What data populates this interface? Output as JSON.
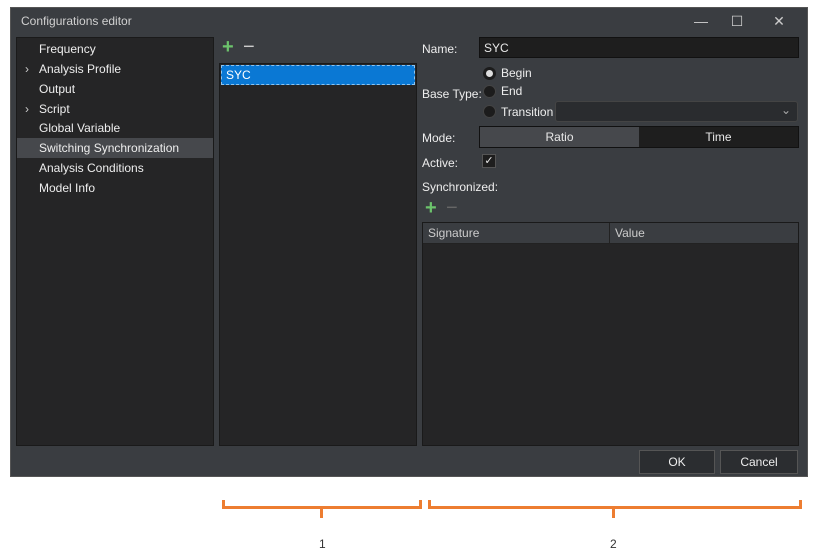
{
  "window": {
    "title": "Configurations editor",
    "controls": [
      "minimize",
      "maximize",
      "close"
    ]
  },
  "tree": {
    "items": [
      {
        "label": "Frequency",
        "expandable": false
      },
      {
        "label": "Analysis Profile",
        "expandable": true
      },
      {
        "label": "Output",
        "expandable": false
      },
      {
        "label": "Script",
        "expandable": true
      },
      {
        "label": "Global Variable",
        "expandable": false
      },
      {
        "label": "Switching Synchronization",
        "expandable": false,
        "selected": true
      },
      {
        "label": "Analysis Conditions",
        "expandable": false
      },
      {
        "label": "Model Info",
        "expandable": false
      }
    ]
  },
  "list": {
    "items": [
      "SYC"
    ],
    "selected": "SYC"
  },
  "form": {
    "name_label": "Name:",
    "name_value": "SYC",
    "base_type_label": "Base Type:",
    "base_type_options": [
      "Begin",
      "End",
      "Transition"
    ],
    "base_type_selected": "Begin",
    "transition_select_value": "",
    "mode_label": "Mode:",
    "mode_options": [
      "Ratio",
      "Time"
    ],
    "mode_selected": "Ratio",
    "active_label": "Active:",
    "active_checked": true,
    "synchronized_label": "Synchronized:",
    "table_headers": [
      "Signature",
      "Value"
    ],
    "table_rows": []
  },
  "buttons": {
    "ok": "OK",
    "cancel": "Cancel"
  },
  "annotations": {
    "one": "1",
    "two": "2",
    "color": "#ed7d31"
  },
  "icons": {
    "add": "+",
    "remove": "−",
    "chevron": "›",
    "dropdown": "⌄",
    "check": "✓",
    "minimize": "—",
    "maximize": "☐",
    "close": "✕"
  }
}
